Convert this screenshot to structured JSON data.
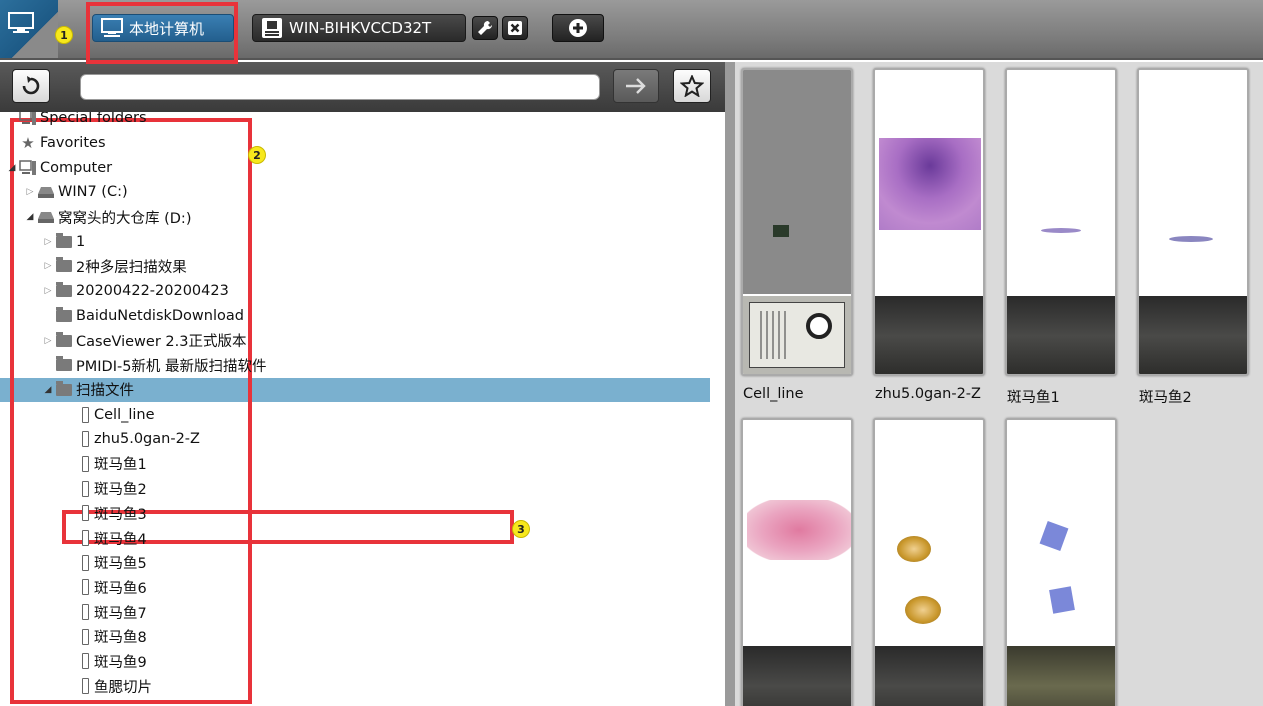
{
  "topbar": {
    "badge1": "1",
    "tabs": [
      {
        "label": "本地计算机",
        "active": true
      },
      {
        "label": "WIN-BIHKVCCD32T",
        "active": false
      }
    ]
  },
  "addressbar": {
    "value": "",
    "placeholder": ""
  },
  "tree": {
    "badge2": "2",
    "badge3": "3",
    "items": [
      {
        "label": "Special folders"
      },
      {
        "label": "Favorites"
      },
      {
        "label": "Computer"
      },
      {
        "label": "WIN7 (C:)"
      },
      {
        "label": "窝窝头的大仓库 (D:)"
      },
      {
        "label": "1"
      },
      {
        "label": "2种多层扫描效果"
      },
      {
        "label": "20200422-20200423"
      },
      {
        "label": "BaiduNetdiskDownload"
      },
      {
        "label": "CaseViewer 2.3正式版本"
      },
      {
        "label": "PMIDI-5新机 最新版扫描软件"
      },
      {
        "label": "扫描文件"
      },
      {
        "label": "Cell_line"
      },
      {
        "label": "zhu5.0gan-2-Z"
      },
      {
        "label": "斑马鱼1"
      },
      {
        "label": "斑马鱼2"
      },
      {
        "label": "斑马鱼3"
      },
      {
        "label": "斑马鱼4"
      },
      {
        "label": "斑马鱼5"
      },
      {
        "label": "斑马鱼6"
      },
      {
        "label": "斑马鱼7"
      },
      {
        "label": "斑马鱼8"
      },
      {
        "label": "斑马鱼9"
      },
      {
        "label": "鱼腮切片"
      }
    ]
  },
  "thumbnails": [
    {
      "caption": "Cell_line"
    },
    {
      "caption": "zhu5.0gan-2-Z"
    },
    {
      "caption": "斑马鱼1"
    },
    {
      "caption": "斑马鱼2"
    },
    {
      "caption": ""
    },
    {
      "caption": ""
    },
    {
      "caption": ""
    }
  ],
  "colors": {
    "accent": "#2c6f9c",
    "selection": "#7ab0cf",
    "highlight": "#e8333a",
    "badge": "#f7e81c"
  }
}
